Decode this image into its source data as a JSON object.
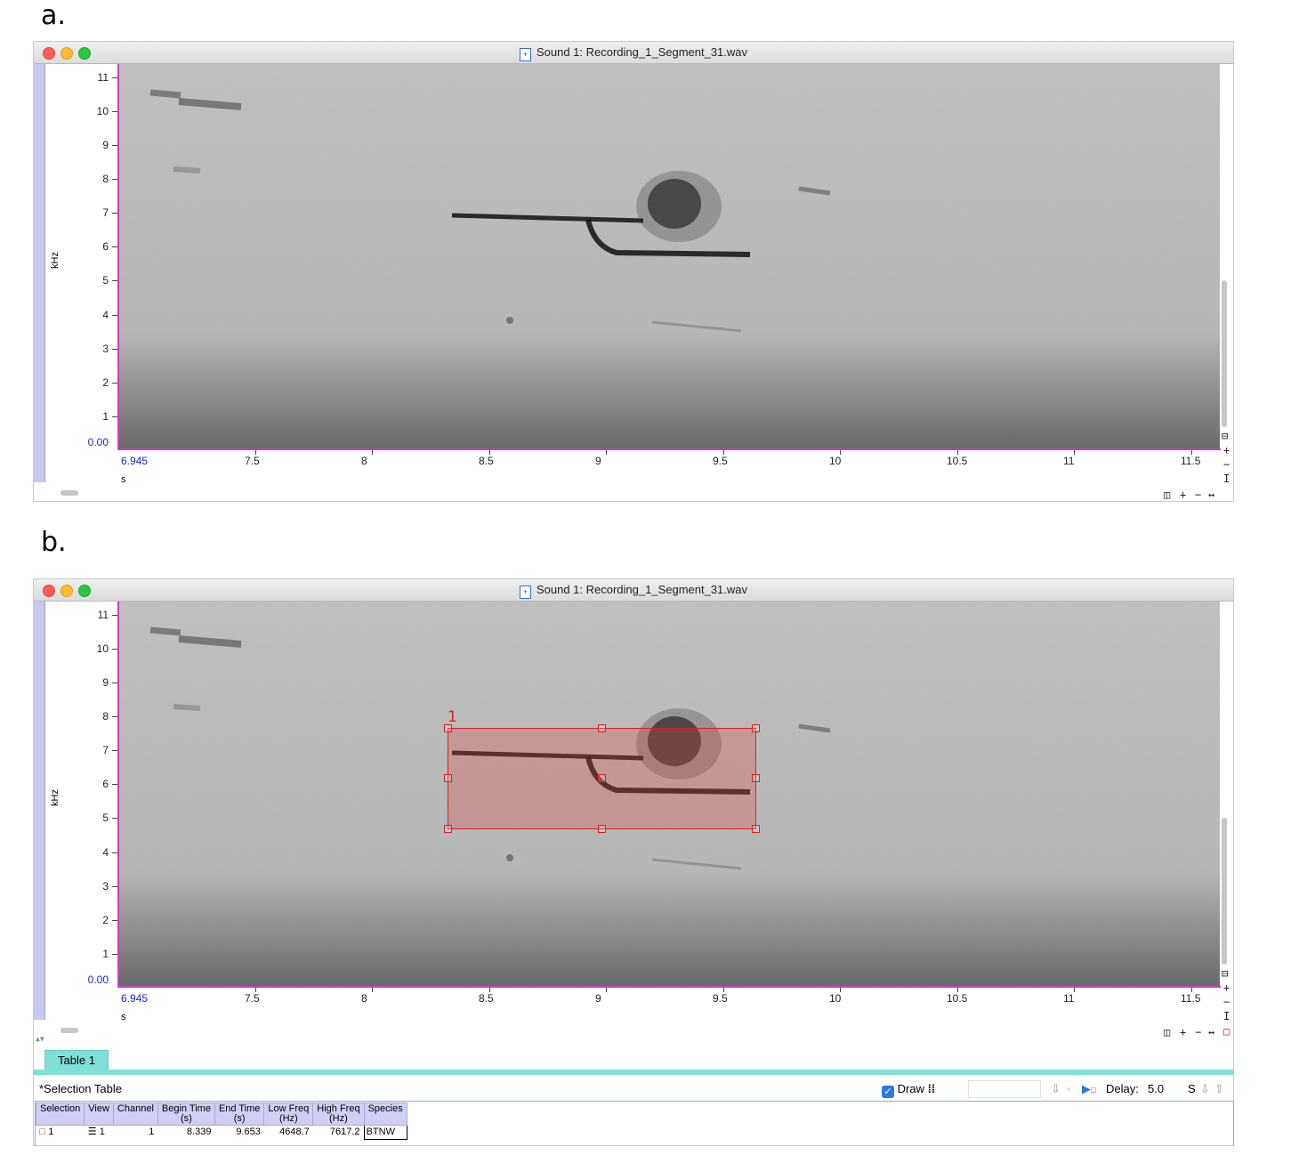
{
  "panel_a": {
    "letter": "a."
  },
  "panel_b": {
    "letter": "b."
  },
  "window": {
    "title": "Sound 1: Recording_1_Segment_31.wav",
    "doc_icon": "document-icon"
  },
  "axis": {
    "y_unit": "kHz",
    "y_ticks": [
      "11",
      "10",
      "9",
      "8",
      "7",
      "6",
      "5",
      "4",
      "3",
      "2",
      "1"
    ],
    "y_zero": "0.00",
    "x_unit": "s",
    "x_start": "6.945",
    "x_ticks": [
      "7.5",
      "8",
      "8.5",
      "9",
      "9.5",
      "10",
      "10.5",
      "11",
      "11.5"
    ]
  },
  "selection": {
    "number": "1"
  },
  "controls": {
    "zoom_plus": "+",
    "zoom_minus": "−"
  },
  "table_tab": {
    "label": "Table 1"
  },
  "selection_table": {
    "title": "*Selection Table",
    "columns": [
      "Selection",
      "View",
      "Channel",
      "Begin Time\n(s)",
      "End Time\n(s)",
      "Low Freq\n(Hz)",
      "High Freq\n(Hz)",
      "Species"
    ],
    "rows": [
      {
        "selection": "1",
        "view": "1",
        "channel": "1",
        "begin": "8.339",
        "end": "9.653",
        "low": "4648.7",
        "high": "7617.2",
        "species": "BTNW"
      }
    ]
  },
  "toolbar": {
    "draw_label": "Draw",
    "delay_label": "Delay:",
    "delay_value": "5.0",
    "delay_unit": "S"
  },
  "colors": {
    "axis": "#c43fc4",
    "selection": "#e02020",
    "tab": "#7fe0d8",
    "header": "#cfcff6"
  }
}
